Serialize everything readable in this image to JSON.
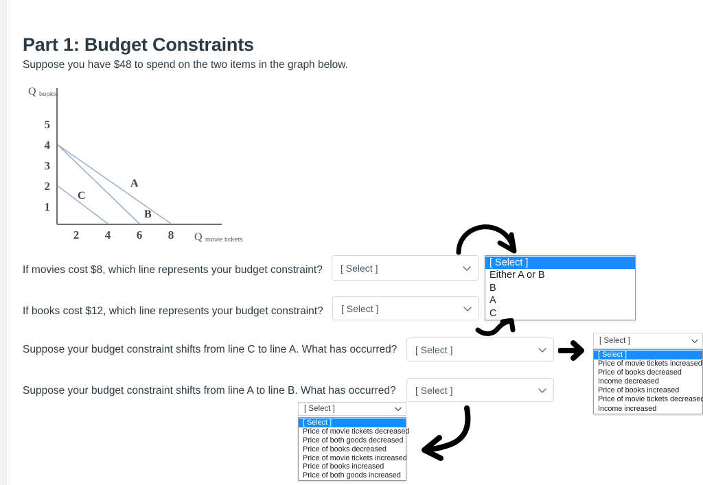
{
  "page": {
    "title": "Part 1: Budget Constraints",
    "intro": "Suppose you have $48 to spend on the two items in the graph below."
  },
  "chart_data": {
    "type": "line",
    "title": "",
    "xlabel": "Q movie tickets",
    "ylabel": "Q books",
    "xlabel_main": "Q",
    "xlabel_sub": "movie tickets",
    "ylabel_main": "Q",
    "ylabel_sub": "books",
    "xlim": [
      0,
      9
    ],
    "ylim": [
      0,
      6
    ],
    "xticks": [
      2,
      4,
      6,
      8
    ],
    "yticks": [
      1,
      2,
      3,
      4,
      5
    ],
    "grid": false,
    "legend": "inline-labels",
    "series": [
      {
        "name": "A",
        "points": [
          [
            0,
            4
          ],
          [
            8,
            0
          ]
        ],
        "label": "A",
        "label_at": [
          5.0,
          1.85
        ]
      },
      {
        "name": "B",
        "points": [
          [
            0,
            4
          ],
          [
            6,
            0
          ]
        ],
        "label": "B",
        "label_at": [
          4.0,
          0.45
        ]
      },
      {
        "name": "C",
        "points": [
          [
            0,
            2
          ],
          [
            4,
            0
          ]
        ],
        "label": "C",
        "label_at": [
          1.35,
          1.3
        ]
      }
    ],
    "line_color": "#9fb3cc",
    "axis_color": "#6f6f6f",
    "tick_label_color": "#4b4b4b"
  },
  "questions": [
    {
      "id": "q-movies-cost-8",
      "text": "If movies cost $8, which line represents your budget constraint?",
      "select_value": "[ Select ]"
    },
    {
      "id": "q-books-cost-12",
      "text": "If books cost $12, which line represents your budget constraint?",
      "select_value": "[ Select ]"
    },
    {
      "id": "q-shift-c-to-a",
      "text": "Suppose your budget constraint shifts from line C to line A. What has occurred?",
      "select_value": "[ Select ]"
    },
    {
      "id": "q-shift-a-to-b",
      "text": "Suppose your budget constraint shifts from line A to line B. What has occurred?",
      "select_value": "[ Select ]"
    }
  ],
  "open_dropdowns": {
    "line_choice": {
      "anchor_value": "[ Select ]",
      "options": [
        "[ Select ]",
        "Either A or B",
        "B",
        "A",
        "C"
      ],
      "selected_index": 0
    },
    "shift_c_to_a": {
      "anchor_value": "[ Select ]",
      "options": [
        "[ Select ]",
        "Price of movie tickets increased",
        "Price of books decreased",
        "Income decreased",
        "Price of books increased",
        "Price of movie tickets decreased",
        "Income increased"
      ],
      "selected_index": 0
    },
    "shift_a_to_b": {
      "anchor_value": "[ Select ]",
      "options": [
        "[ Select ]",
        "Price of movie tickets decreased",
        "Price of both goods decreased",
        "Price of books decreased",
        "Price of movie tickets increased",
        "Price of books increased",
        "Price of both goods increased"
      ],
      "selected_index": 0
    }
  },
  "annotations": [
    {
      "name": "curved-arrow-down-right",
      "描述": "curved arrow pointing to first open dropdown"
    },
    {
      "name": "small-arrow-up-right",
      "描述": "small arrow pointing up-right"
    },
    {
      "name": "thick-arrow-right",
      "描述": "thick straight arrow pointing right"
    },
    {
      "name": "curved-arrow-down-left",
      "描述": "curved arrow pointing down-left"
    }
  ],
  "colors": {
    "highlight_blue": "#1a8cff",
    "text_dark": "#2d3b45",
    "select_border": "#d6d9dc",
    "graph_line": "#9fb3cc"
  }
}
